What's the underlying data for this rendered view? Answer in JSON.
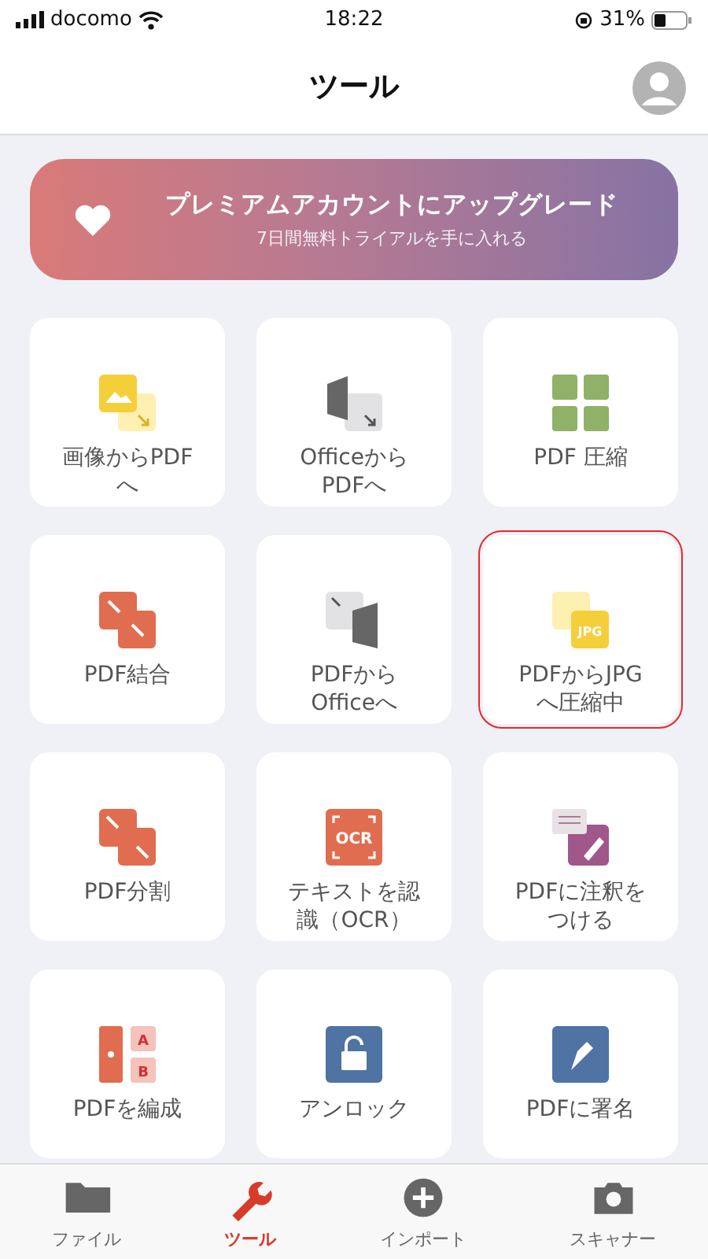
{
  "status_bar": {
    "carrier": "docomo",
    "time": "18:22",
    "battery": "31%"
  },
  "header": {
    "title": "ツール"
  },
  "banner": {
    "title": "プレミアムアカウントにアップグレード",
    "subtitle": "7日間無料トライアルを手に入れる"
  },
  "tools": [
    {
      "kind": "image",
      "label": "画像からPDFへ",
      "highlighted": false
    },
    {
      "kind": "officein",
      "label": "OfficeからPDFへ",
      "highlighted": false
    },
    {
      "kind": "compress",
      "label": "PDF 圧縮",
      "highlighted": false
    },
    {
      "kind": "merge",
      "label": "PDF結合",
      "highlighted": false
    },
    {
      "kind": "officeout",
      "label": "PDFからOfficeへ",
      "highlighted": false
    },
    {
      "kind": "jpg",
      "label": "PDFからJPGへ圧縮中",
      "icon_text": [
        "JPG"
      ],
      "highlighted": true
    },
    {
      "kind": "split",
      "label": "PDF分割",
      "highlighted": false
    },
    {
      "kind": "ocr",
      "label": "テキストを認識（OCR）",
      "icon_text": [
        "OCR"
      ],
      "highlighted": false
    },
    {
      "kind": "annotate",
      "label": "PDFに注釈をつける",
      "highlighted": false
    },
    {
      "kind": "organize",
      "label": "PDFを編成",
      "icon_text": [
        "A",
        "B"
      ],
      "highlighted": false
    },
    {
      "kind": "unlock",
      "label": "アンロック",
      "highlighted": false
    },
    {
      "kind": "sign",
      "label": "PDFに署名",
      "highlighted": false
    }
  ],
  "tab_bar": [
    {
      "kind": "folder",
      "label": "ファイル",
      "selected": false
    },
    {
      "kind": "wrench",
      "label": "ツール",
      "selected": true
    },
    {
      "kind": "plus",
      "label": "インポート",
      "selected": false
    },
    {
      "kind": "camera",
      "label": "スキャナー",
      "selected": false
    }
  ]
}
